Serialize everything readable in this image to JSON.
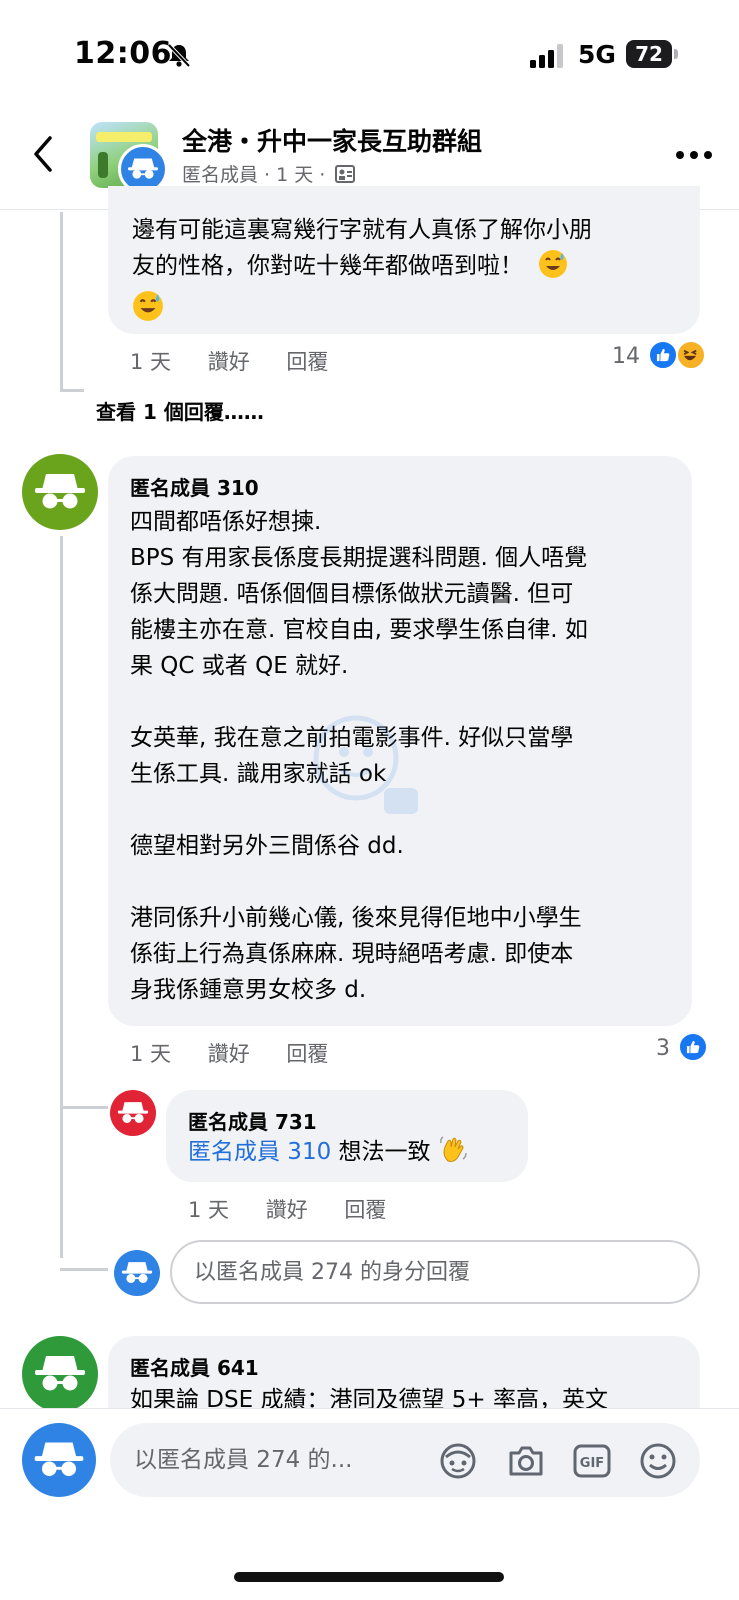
{
  "status_bar": {
    "time": "12:06",
    "network": "5G",
    "battery": "72"
  },
  "header": {
    "title": "全港・升中一家長互助群組",
    "subtitle": "匿名成員 · 1 天 ·"
  },
  "comments": [
    {
      "lines": [
        "邊有可能這裏寫幾行字就有人真係了解你小朋",
        "友的性格，你對咗十幾年都做唔到啦！"
      ],
      "time": "1 天",
      "like_label": "讚好",
      "reply_label": "回覆",
      "reaction_count": "14"
    },
    {
      "author": "匿名成員 310",
      "lines": [
        "四間都唔係好想揀.",
        "BPS 有用家長係度長期提選科問題. 個人唔覺",
        "係大問題. 唔係個個目標係做狀元讀醫. 但可",
        "能樓主亦在意. 官校自由, 要求學生係自律. 如",
        "果 QC 或者 QE 就好.",
        "",
        "女英華, 我在意之前拍電影事件. 好似只當學",
        "生係工具. 識用家就話 ok",
        "",
        "德望相對另外三間係谷 dd.",
        "",
        "港同係升小前幾心儀, 後來見得佢地中小學生",
        "係街上行為真係麻麻. 現時絕唔考慮. 即使本",
        "身我係鍾意男女校多 d."
      ],
      "time": "1 天",
      "like_label": "讚好",
      "reply_label": "回覆",
      "reaction_count": "3"
    },
    {
      "author": "匿名成員 731",
      "mention": "匿名成員 310",
      "text": "想法一致",
      "time": "1 天",
      "like_label": "讚好",
      "reply_label": "回覆"
    },
    {
      "author": "匿名成員 641",
      "lines": [
        "如果論 DSE 成績：港同及德望 5+ 率高，英文"
      ]
    }
  ],
  "view_replies": "查看 1 個回覆……",
  "reply_box": {
    "placeholder": "以匿名成員 274 的身分回覆"
  },
  "composer": {
    "placeholder": "以匿名成員 274 的..."
  },
  "colors": {
    "accent": "#1877f2",
    "avatar_green": "#6aa41d",
    "avatar_dark_green": "#2e9a3a",
    "avatar_red": "#e02435",
    "avatar_blue": "#2f83e4",
    "bubble": "#f0f2f5"
  },
  "icons": [
    "back-icon",
    "more-icon",
    "like-icon",
    "haha-icon",
    "sweat-smile-emoji",
    "wave-emoji",
    "avatar-icon",
    "camera-icon",
    "gif-icon",
    "smiley-icon"
  ]
}
